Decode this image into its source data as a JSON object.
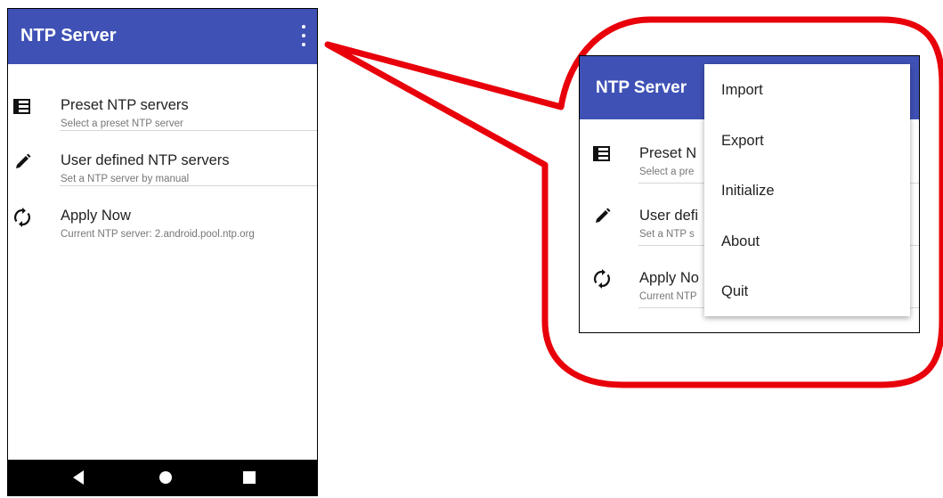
{
  "app": {
    "title": "NTP Server"
  },
  "list": [
    {
      "title": "Preset NTP servers",
      "subtitle": "Select a preset NTP server",
      "icon": "list-icon"
    },
    {
      "title": "User defined NTP servers",
      "subtitle": "Set a NTP server by manual",
      "icon": "pencil-icon"
    },
    {
      "title": "Apply Now",
      "subtitle": "Current NTP server: 2.android.pool.ntp.org",
      "icon": "sync-icon"
    }
  ],
  "zoom_list": [
    {
      "title": "Preset N",
      "subtitle": "Select a pre"
    },
    {
      "title": "User defi",
      "subtitle": "Set a NTP s"
    },
    {
      "title": "Apply No",
      "subtitle": "Current NTP"
    }
  ],
  "menu": [
    "Import",
    "Export",
    "Initialize",
    "About",
    "Quit"
  ],
  "colors": {
    "primary": "#3f51b5",
    "callout": "#e8000b"
  }
}
